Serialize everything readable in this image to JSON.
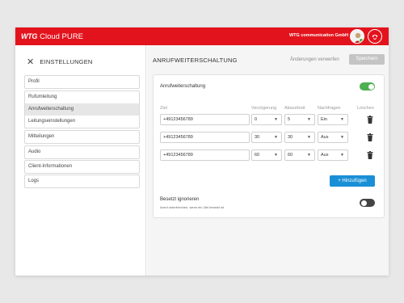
{
  "header": {
    "brand_prefix": "WTG",
    "brand_name": "Cloud PURE",
    "company": "WTG communication GmbH",
    "accent_color": "#e3131d"
  },
  "sidebar": {
    "title": "EINSTELLUNGEN",
    "close_icon": "close-icon",
    "groups": [
      {
        "items": [
          {
            "label": "Profil"
          }
        ]
      },
      {
        "items": [
          {
            "label": "Rufumleitung"
          },
          {
            "label": "Anrufweiterschaltung",
            "active": true
          },
          {
            "label": "Leitungseinstellungen"
          }
        ]
      },
      {
        "items": [
          {
            "label": "Mitteilungen"
          }
        ]
      },
      {
        "items": [
          {
            "label": "Audio"
          }
        ]
      },
      {
        "items": [
          {
            "label": "Client-Informationen"
          }
        ]
      },
      {
        "items": [
          {
            "label": "Logs"
          }
        ]
      }
    ]
  },
  "main": {
    "title": "ANRUFWEITERSCHALTUNG",
    "discard_label": "Änderungen verwerfen",
    "save_label": "Speichern",
    "card": {
      "title": "Anrufweiterschaltung",
      "enabled": true,
      "columns": {
        "target": "Ziel",
        "delay": "Verzögerung",
        "timeout": "Abwurfzeit",
        "ask": "Nachfragen",
        "delete": "Löschen"
      },
      "rows": [
        {
          "target": "+49123456789",
          "delay": "0",
          "timeout": "5",
          "ask": "Ein"
        },
        {
          "target": "+49123456789",
          "delay": "30",
          "timeout": "30",
          "ask": "Aus"
        },
        {
          "target": "+49123456789",
          "delay": "60",
          "timeout": "60",
          "ask": "Aus"
        }
      ],
      "add_label": "+ Hinzufügen",
      "busy_title": "Besetzt ignorieren",
      "busy_desc": "Anruf unterbrechen, wenn ein Ziel besetzt ist.",
      "busy_enabled": false
    }
  }
}
